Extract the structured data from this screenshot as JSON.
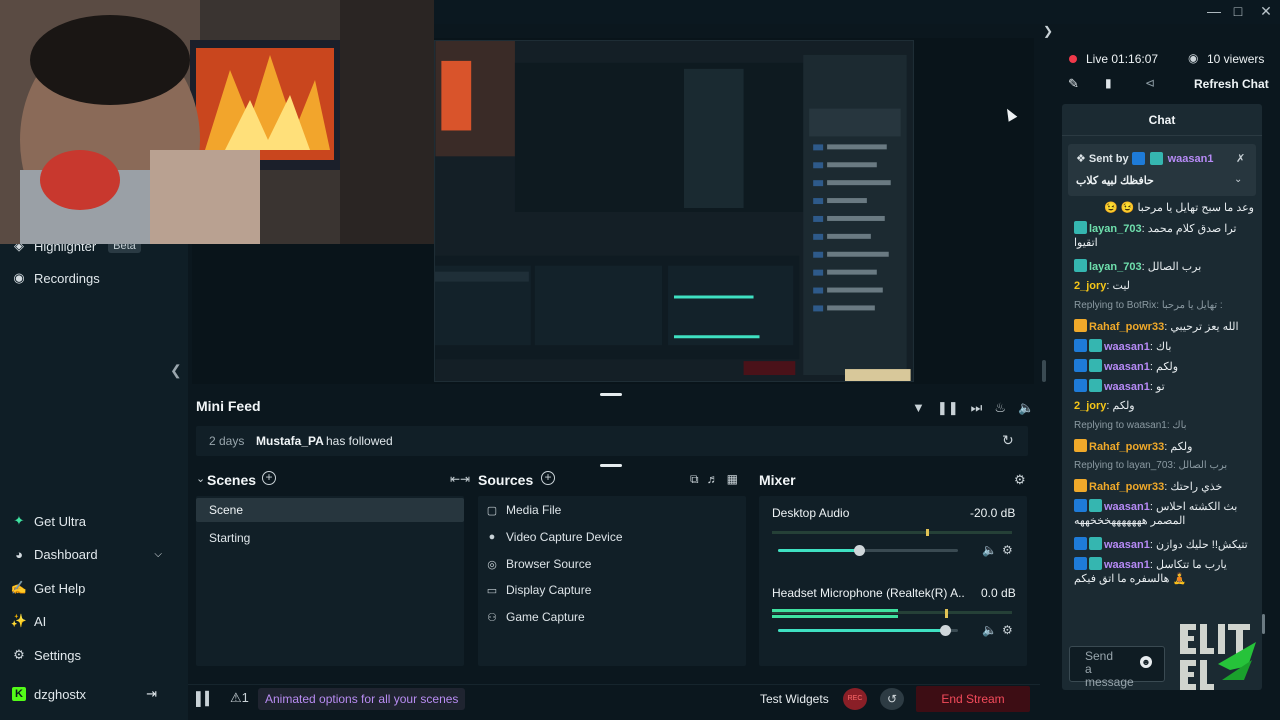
{
  "sidebar": {
    "highlighter_label": "Highlighter",
    "beta_label": "Beta",
    "recordings_label": "Recordings",
    "items": [
      {
        "label": "Get Ultra",
        "icon": "ultra-icon"
      },
      {
        "label": "Dashboard",
        "icon": "dashboard-icon"
      },
      {
        "label": "Get Help",
        "icon": "help-icon"
      },
      {
        "label": "AI",
        "icon": "ai-sparkle-icon"
      },
      {
        "label": "Settings",
        "icon": "gear-icon"
      }
    ],
    "user": "dzghostx"
  },
  "minifeed": {
    "title": "Mini Feed",
    "event": {
      "age": "2 days",
      "user": "Mustafa_PA",
      "action": "has followed"
    }
  },
  "scenes": {
    "title": "Scenes",
    "items": [
      "Scene",
      "Starting"
    ]
  },
  "sources": {
    "title": "Sources",
    "items": [
      {
        "label": "Media File",
        "icon": "media-file-icon"
      },
      {
        "label": "Video Capture Device",
        "icon": "camera-icon"
      },
      {
        "label": "Browser Source",
        "icon": "globe-icon"
      },
      {
        "label": "Display Capture",
        "icon": "monitor-icon"
      },
      {
        "label": "Game Capture",
        "icon": "gamepad-icon"
      }
    ]
  },
  "mixer": {
    "title": "Mixer",
    "channels": [
      {
        "name": "Desktop Audio",
        "db": "-20.0 dB",
        "level": 0.45
      },
      {
        "name": "Headset Microphone (Realtek(R) A...",
        "db": "0.0 dB",
        "level": 0.93
      }
    ]
  },
  "bottom": {
    "promo": "Animated options for all your scenes",
    "test_widgets": "Test Widgets",
    "end_stream": "End Stream",
    "rec_label": "REC"
  },
  "status": {
    "live": "Live 01:16:07",
    "viewers": "10 viewers",
    "refresh": "Refresh Chat"
  },
  "chat": {
    "title": "Chat",
    "pinned": {
      "sent_by": "Sent by",
      "user": "waasan1",
      "text": "حافظك لبيه كلاب"
    },
    "placeholder": "Send a message",
    "messages": [
      {
        "type": "text",
        "text": "وعد ما سبح تهايل يا مرحبا 😉 😉"
      },
      {
        "type": "msg",
        "user": "layan_703",
        "color": "#6fe0ad",
        "text": "ترا صدق كلام محمد اتقيوا"
      },
      {
        "type": "msg",
        "user": "layan_703",
        "color": "#6fe0ad",
        "text": "برب الصالل"
      },
      {
        "type": "msg",
        "user": "2_jory",
        "color": "#f5c518",
        "text": "ليت"
      },
      {
        "type": "reply",
        "text": "Replying to BotRix: تهايل يا مرحبا :"
      },
      {
        "type": "msg",
        "user": "Rahaf_powr33",
        "color": "#f0a92a",
        "text": "الله يعز ترحيبي"
      },
      {
        "type": "msg",
        "user": "waasan1",
        "color": "#b68af5",
        "text": "باك"
      },
      {
        "type": "msg",
        "user": "waasan1",
        "color": "#b68af5",
        "text": "ولكم"
      },
      {
        "type": "msg",
        "user": "waasan1",
        "color": "#b68af5",
        "text": "تو"
      },
      {
        "type": "msg",
        "user": "2_jory",
        "color": "#f5c518",
        "text": "ولكم"
      },
      {
        "type": "reply",
        "text": "Replying to waasan1: باك"
      },
      {
        "type": "msg",
        "user": "Rahaf_powr33",
        "color": "#f0a92a",
        "text": "ولكم"
      },
      {
        "type": "reply",
        "text": "Replying to layan_703: برب الصالل"
      },
      {
        "type": "msg",
        "user": "Rahaf_powr33",
        "color": "#f0a92a",
        "text": "خذي راحتك"
      },
      {
        "type": "msg",
        "user": "waasan1",
        "color": "#b68af5",
        "text": "بث الكشته احلاس المصمر هههههههخخخههه"
      },
      {
        "type": "msg",
        "user": "waasan1",
        "color": "#b68af5",
        "text": "تتيكش!! حليك دوازن"
      },
      {
        "type": "msg",
        "user": "waasan1",
        "color": "#b68af5",
        "text": "يارب ما تتكاسل هالسفره ما اتق فيكم 🧘"
      }
    ]
  }
}
